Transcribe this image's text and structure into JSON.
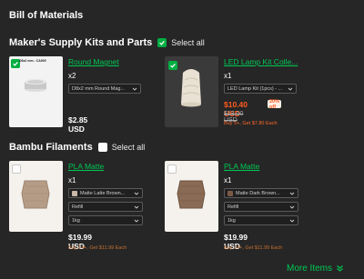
{
  "page": {
    "title": "Bill of Materials",
    "more_items": "More Items",
    "accent": "#00ae42",
    "sale_color": "#ff5a1f"
  },
  "sections": [
    {
      "name": "Maker's Supply Kits and Parts",
      "select_all_checked": true,
      "select_all_label": "Select all",
      "items": [
        {
          "name": "Round Magnet",
          "checked": true,
          "thumb_tag": "D8x2 mm - CA009",
          "qty": "x2",
          "variant": "D8x2 mm Round Mag...",
          "price": "$2.85 USD"
        },
        {
          "name": "LED Lamp Kit Colle...",
          "checked": true,
          "qty": "x1",
          "variant": "LED Lamp Kit (1pcs) - ...",
          "price": "$10.40 USD",
          "discount": "20% off",
          "old_price": "$13.00 USD",
          "promo": "Buy 5+, Get $7.80 Each"
        }
      ]
    },
    {
      "name": "Bambu Filaments",
      "select_all_checked": false,
      "select_all_label": "Select all",
      "items": [
        {
          "name": "PLA Matte",
          "checked": false,
          "qty": "x1",
          "color_name": "Matte Latte Brown...",
          "swatch": "#c8b7a6",
          "type": "Refill",
          "weight": "1kg",
          "price": "$19.99 USD",
          "promo": "Buy 14+, Get $11.99 Each"
        },
        {
          "name": "PLA Matte",
          "checked": false,
          "qty": "x1",
          "color_name": "Matte Dark Brown...",
          "swatch": "#7a5a45",
          "type": "Refill",
          "weight": "1kg",
          "price": "$19.99 USD",
          "promo": "Buy 14+, Get $11.99 Each"
        }
      ]
    }
  ]
}
